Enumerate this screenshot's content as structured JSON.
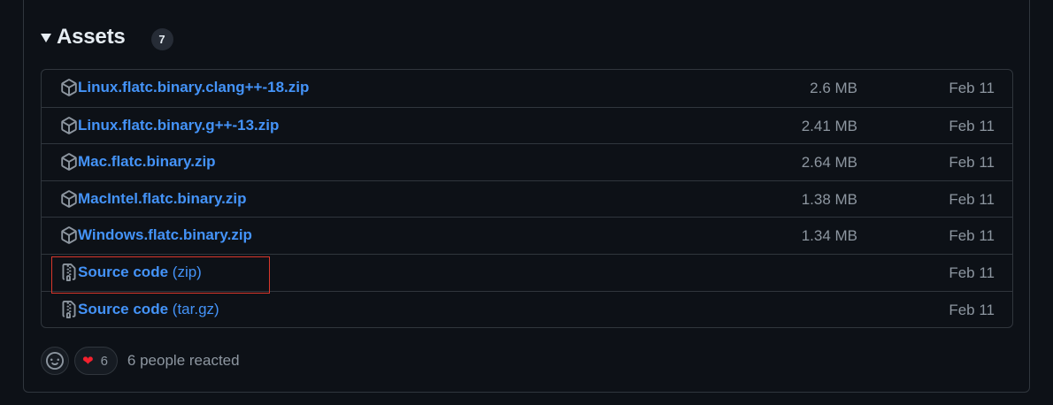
{
  "assets": {
    "title": "Assets",
    "count": "7",
    "items": [
      {
        "name": "Linux.flatc.binary.clang++-18.zip",
        "ext": "",
        "size": "2.6 MB",
        "date": "Feb 11",
        "icon": "package-icon"
      },
      {
        "name": "Linux.flatc.binary.g++-13.zip",
        "ext": "",
        "size": "2.41 MB",
        "date": "Feb 11",
        "icon": "package-icon"
      },
      {
        "name": "Mac.flatc.binary.zip",
        "ext": "",
        "size": "2.64 MB",
        "date": "Feb 11",
        "icon": "package-icon"
      },
      {
        "name": "MacIntel.flatc.binary.zip",
        "ext": "",
        "size": "1.38 MB",
        "date": "Feb 11",
        "icon": "package-icon"
      },
      {
        "name": "Windows.flatc.binary.zip",
        "ext": "",
        "size": "1.34 MB",
        "date": "Feb 11",
        "icon": "package-icon"
      },
      {
        "name": "Source code",
        "ext": "(zip)",
        "size": "",
        "date": "Feb 11",
        "icon": "file-zip-icon"
      },
      {
        "name": "Source code",
        "ext": "(tar.gz)",
        "size": "",
        "date": "Feb 11",
        "icon": "file-zip-icon"
      }
    ]
  },
  "reactions": {
    "heart_count": "6",
    "summary": "6 people reacted"
  },
  "colors": {
    "background": "#0d1117",
    "border": "#30363d",
    "link": "#4493f8",
    "muted": "#8d96a0",
    "highlight": "#d9372b",
    "heart": "#f4212e"
  }
}
